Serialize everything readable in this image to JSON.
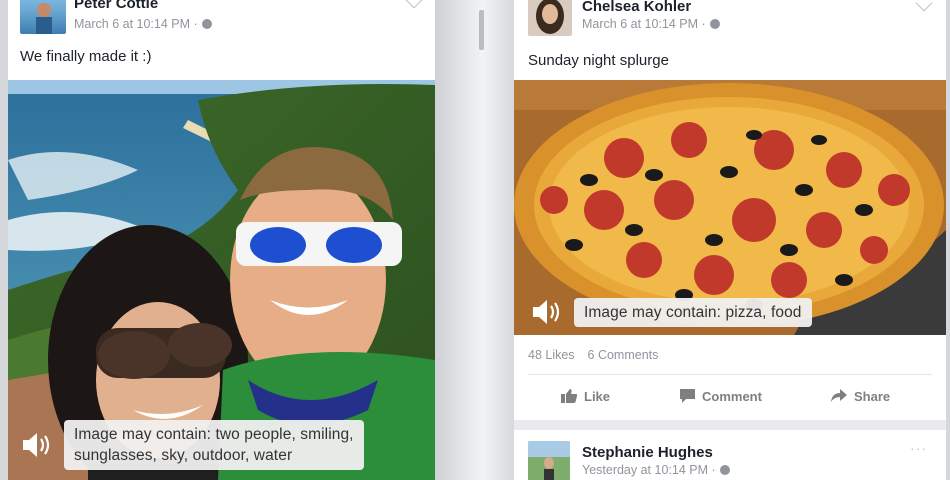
{
  "left_post": {
    "author": "Peter Cottle",
    "timestamp": "March 6 at 10:14 PM",
    "separator": "·",
    "text": "We finally made it :)",
    "alt_text_line1": "Image may contain: two people, smiling,",
    "alt_text_line2": "sunglasses, sky, outdoor, water"
  },
  "right_post": {
    "author": "Chelsea Kohler",
    "timestamp": "March 6 at 10:14 PM",
    "separator": "·",
    "text": "Sunday night splurge",
    "alt_text": "Image may contain: pizza, food",
    "likes": "48 Likes",
    "comments": "6 Comments",
    "actions": {
      "like": "Like",
      "comment": "Comment",
      "share": "Share"
    }
  },
  "next_post": {
    "author": "Stephanie Hughes",
    "timestamp": "Yesterday at 10:14 PM",
    "separator": "·",
    "menu": "···"
  },
  "icons": [
    "globe-icon",
    "chevron-down-icon",
    "speaker-icon",
    "like-icon",
    "comment-icon",
    "share-icon"
  ],
  "colors": {
    "name": "#1d2129",
    "meta": "#90949c",
    "action": "#7f7f7f",
    "background": "#e9eaed"
  }
}
